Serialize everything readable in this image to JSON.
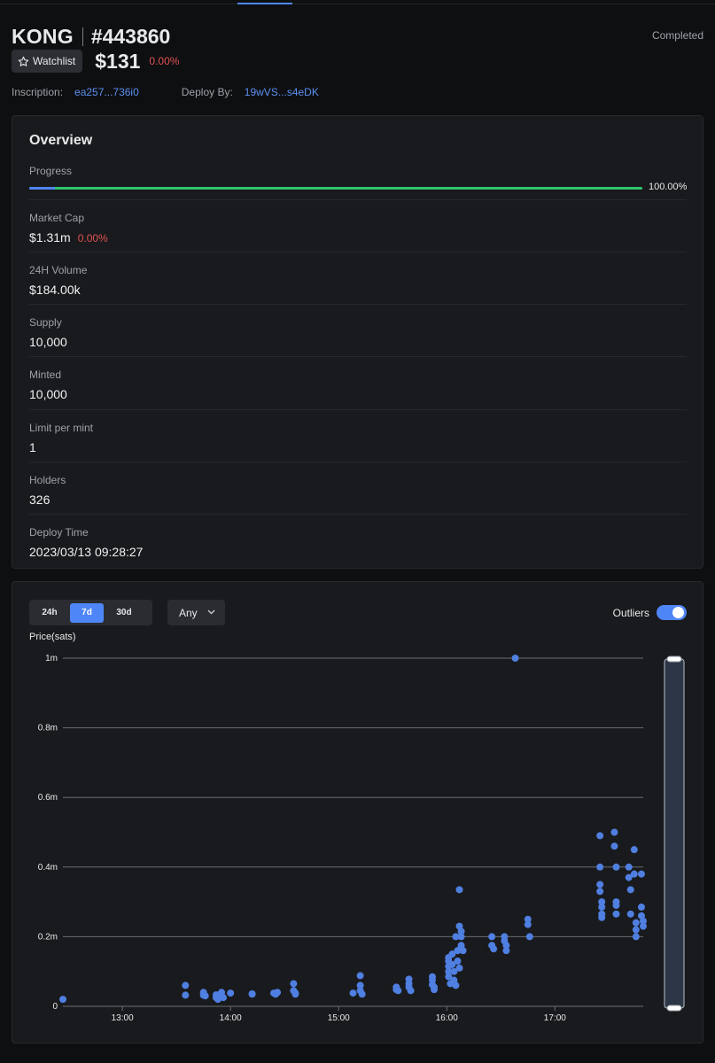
{
  "header": {
    "ticker": "KONG",
    "inscription_number": "#443860",
    "status": "Completed",
    "watchlist_label": "Watchlist",
    "price": "$131",
    "price_change": "0.00%",
    "inscription_label": "Inscription:",
    "inscription_value": "ea257...736i0",
    "deploy_label": "Deploy By:",
    "deploy_value": "19wVS...s4eDK"
  },
  "overview": {
    "title": "Overview",
    "progress_label": "Progress",
    "progress_value": "100.00%",
    "progress_fraction": 1.0,
    "market_cap_label": "Market Cap",
    "market_cap_value": "$1.31m",
    "market_cap_change": "0.00%",
    "volume_label": "24H Volume",
    "volume_value": "$184.00k",
    "supply_label": "Supply",
    "supply_value": "10,000",
    "minted_label": "Minted",
    "minted_value": "10,000",
    "limit_label": "Limit per mint",
    "limit_value": "1",
    "holders_label": "Holders",
    "holders_value": "326",
    "deploy_time_label": "Deploy Time",
    "deploy_time_value": "2023/03/13 09:28:27"
  },
  "chart_controls": {
    "ranges": [
      "24h",
      "7d",
      "30d"
    ],
    "active_range": "7d",
    "filter_value": "Any",
    "outliers_label": "Outliers",
    "outliers_on": true
  },
  "chart_data": {
    "type": "scatter",
    "ylabel": "Price(sats)",
    "ylim": [
      0,
      1000000
    ],
    "y_ticks": [
      {
        "value": 0,
        "label": "0"
      },
      {
        "value": 200000,
        "label": "0.2m"
      },
      {
        "value": 400000,
        "label": "0.4m"
      },
      {
        "value": 600000,
        "label": "0.6m"
      },
      {
        "value": 800000,
        "label": "0.8m"
      },
      {
        "value": 1000000,
        "label": "1m"
      }
    ],
    "x_ticks": [
      "13:00",
      "14:00",
      "15:00",
      "16:00",
      "17:00"
    ],
    "xlim": [
      "12:27",
      "17:49"
    ],
    "grid": true,
    "color": "#4f7fe0",
    "points": [
      [
        "12:27",
        20000
      ],
      [
        "13:35",
        60000
      ],
      [
        "13:35",
        32000
      ],
      [
        "13:45",
        40000
      ],
      [
        "13:45",
        32000
      ],
      [
        "13:46",
        30000
      ],
      [
        "13:52",
        33000
      ],
      [
        "13:52",
        25000
      ],
      [
        "13:53",
        20000
      ],
      [
        "13:55",
        40000
      ],
      [
        "13:55",
        30000
      ],
      [
        "13:56",
        25000
      ],
      [
        "14:00",
        38000
      ],
      [
        "14:12",
        36000
      ],
      [
        "14:12",
        35000
      ],
      [
        "14:24",
        38000
      ],
      [
        "14:25",
        35000
      ],
      [
        "14:26",
        40000
      ],
      [
        "14:35",
        65000
      ],
      [
        "14:35",
        45000
      ],
      [
        "14:36",
        38000
      ],
      [
        "14:36",
        35000
      ],
      [
        "15:08",
        38000
      ],
      [
        "15:12",
        88000
      ],
      [
        "15:12",
        60000
      ],
      [
        "15:12",
        45000
      ],
      [
        "15:13",
        35000
      ],
      [
        "15:32",
        55000
      ],
      [
        "15:32",
        48000
      ],
      [
        "15:33",
        45000
      ],
      [
        "15:39",
        78000
      ],
      [
        "15:39",
        65000
      ],
      [
        "15:39",
        55000
      ],
      [
        "15:40",
        45000
      ],
      [
        "15:52",
        85000
      ],
      [
        "15:52",
        75000
      ],
      [
        "15:52",
        62000
      ],
      [
        "15:53",
        55000
      ],
      [
        "15:53",
        48000
      ],
      [
        "16:01",
        140000
      ],
      [
        "16:01",
        130000
      ],
      [
        "16:01",
        115000
      ],
      [
        "16:01",
        100000
      ],
      [
        "16:01",
        85000
      ],
      [
        "16:02",
        65000
      ],
      [
        "16:03",
        150000
      ],
      [
        "16:03",
        120000
      ],
      [
        "16:04",
        100000
      ],
      [
        "16:04",
        75000
      ],
      [
        "16:05",
        60000
      ],
      [
        "16:05",
        200000
      ],
      [
        "16:06",
        160000
      ],
      [
        "16:06",
        130000
      ],
      [
        "16:07",
        110000
      ],
      [
        "16:07",
        335000
      ],
      [
        "16:07",
        230000
      ],
      [
        "16:08",
        215000
      ],
      [
        "16:08",
        200000
      ],
      [
        "16:08",
        175000
      ],
      [
        "16:09",
        160000
      ],
      [
        "16:25",
        200000
      ],
      [
        "16:25",
        175000
      ],
      [
        "16:26",
        165000
      ],
      [
        "16:32",
        200000
      ],
      [
        "16:32",
        188000
      ],
      [
        "16:33",
        175000
      ],
      [
        "16:33",
        160000
      ],
      [
        "16:38",
        1000000
      ],
      [
        "16:45",
        250000
      ],
      [
        "16:45",
        235000
      ],
      [
        "16:46",
        200000
      ],
      [
        "17:25",
        490000
      ],
      [
        "17:25",
        400000
      ],
      [
        "17:25",
        350000
      ],
      [
        "17:25",
        330000
      ],
      [
        "17:26",
        300000
      ],
      [
        "17:26",
        285000
      ],
      [
        "17:26",
        265000
      ],
      [
        "17:26",
        255000
      ],
      [
        "17:33",
        500000
      ],
      [
        "17:33",
        460000
      ],
      [
        "17:34",
        400000
      ],
      [
        "17:34",
        300000
      ],
      [
        "17:34",
        290000
      ],
      [
        "17:34",
        265000
      ],
      [
        "17:41",
        400000
      ],
      [
        "17:41",
        370000
      ],
      [
        "17:42",
        335000
      ],
      [
        "17:42",
        265000
      ],
      [
        "17:44",
        450000
      ],
      [
        "17:44",
        380000
      ],
      [
        "17:45",
        240000
      ],
      [
        "17:45",
        220000
      ],
      [
        "17:45",
        200000
      ],
      [
        "17:48",
        380000
      ],
      [
        "17:48",
        285000
      ],
      [
        "17:48",
        260000
      ],
      [
        "17:49",
        245000
      ],
      [
        "17:49",
        230000
      ]
    ]
  }
}
